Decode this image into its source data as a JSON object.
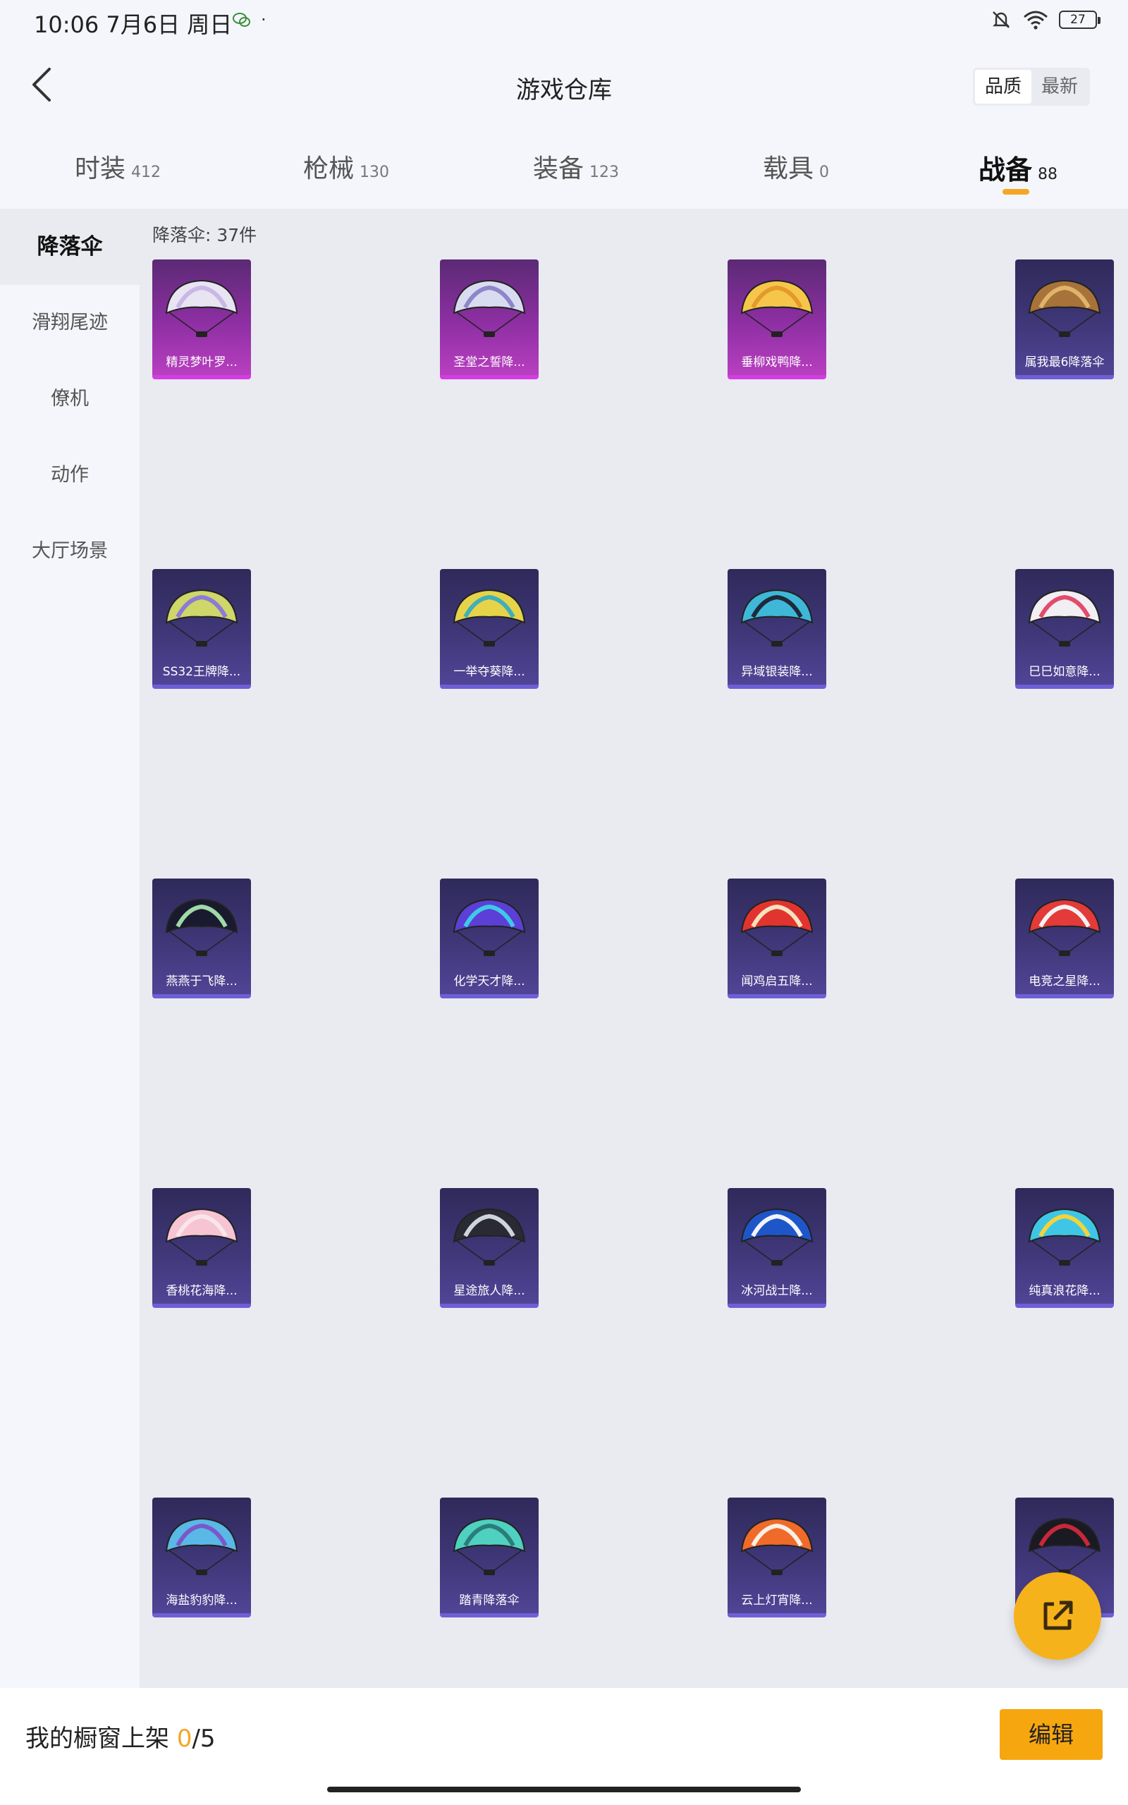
{
  "status": {
    "time": "10:06",
    "date": "7月6日 周日",
    "dot": "·",
    "battery": "27"
  },
  "header": {
    "title": "游戏仓库",
    "sort_options": [
      "品质",
      "最新"
    ]
  },
  "tabs": [
    {
      "label": "时装",
      "count": "412"
    },
    {
      "label": "枪械",
      "count": "130"
    },
    {
      "label": "装备",
      "count": "123"
    },
    {
      "label": "载具",
      "count": "0"
    },
    {
      "label": "战备",
      "count": "88"
    }
  ],
  "sidebar": {
    "items": [
      "降落伞",
      "滑翔尾迹",
      "僚机",
      "动作",
      "大厅场景"
    ]
  },
  "content": {
    "count_label": "降落伞: 37件"
  },
  "items": [
    {
      "name": "精灵梦叶罗...",
      "rarity": "purple",
      "colors": [
        "#e9e4f2",
        "#c9b8e6"
      ]
    },
    {
      "name": "圣堂之誓降...",
      "rarity": "purple",
      "colors": [
        "#d9dcf0",
        "#8f86c9"
      ]
    },
    {
      "name": "垂柳戏鸭降...",
      "rarity": "purple",
      "colors": [
        "#f6c64a",
        "#e49a2a"
      ]
    },
    {
      "name": "属我最6降落伞",
      "rarity": "blue",
      "colors": [
        "#a8733a",
        "#e0b46a"
      ]
    },
    {
      "name": "SS32王牌降...",
      "rarity": "blue",
      "colors": [
        "#cfd66a",
        "#8b7bd6"
      ]
    },
    {
      "name": "一举夺葵降...",
      "rarity": "blue",
      "colors": [
        "#e6d34a",
        "#3fb0b8"
      ]
    },
    {
      "name": "异域银装降...",
      "rarity": "blue",
      "colors": [
        "#3fb7d9",
        "#1e2a3a"
      ]
    },
    {
      "name": "巳巳如意降...",
      "rarity": "blue",
      "colors": [
        "#f1eef4",
        "#e24b6a"
      ]
    },
    {
      "name": "燕燕于飞降...",
      "rarity": "blue",
      "colors": [
        "#1a1a2e",
        "#9fd9a8"
      ]
    },
    {
      "name": "化学天才降...",
      "rarity": "blue",
      "colors": [
        "#5b3fd6",
        "#3ec9e6"
      ]
    },
    {
      "name": "闻鸡启五降...",
      "rarity": "blue",
      "colors": [
        "#e2342e",
        "#f3e2c0"
      ]
    },
    {
      "name": "电竞之星降...",
      "rarity": "blue",
      "colors": [
        "#e33a3a",
        "#f2f2f2"
      ]
    },
    {
      "name": "香桃花海降...",
      "rarity": "blue",
      "colors": [
        "#f6c4d2",
        "#f8e6ec"
      ]
    },
    {
      "name": "星途旅人降...",
      "rarity": "blue",
      "colors": [
        "#2a2a34",
        "#cfd4dc"
      ]
    },
    {
      "name": "冰河战士降...",
      "rarity": "blue",
      "colors": [
        "#1e56c9",
        "#f1f4fa"
      ]
    },
    {
      "name": "纯真浪花降...",
      "rarity": "blue",
      "colors": [
        "#3fc6e6",
        "#f2d43a"
      ]
    },
    {
      "name": "海盐豹豹降...",
      "rarity": "blue",
      "colors": [
        "#5ab8e6",
        "#7b58c9"
      ]
    },
    {
      "name": "踏青降落伞",
      "rarity": "blue",
      "colors": [
        "#4fd0c0",
        "#2a7d78"
      ]
    },
    {
      "name": "云上灯宵降...",
      "rarity": "blue",
      "colors": [
        "#f06a2a",
        "#f7f0e6"
      ]
    },
    {
      "name": "",
      "rarity": "blue",
      "colors": [
        "#1a1a22",
        "#c9283a"
      ]
    }
  ],
  "bottom": {
    "showcase_label": "我的橱窗上架 ",
    "showcase_current": "0",
    "showcase_sep": "/",
    "showcase_total": "5",
    "edit_label": "编辑"
  }
}
